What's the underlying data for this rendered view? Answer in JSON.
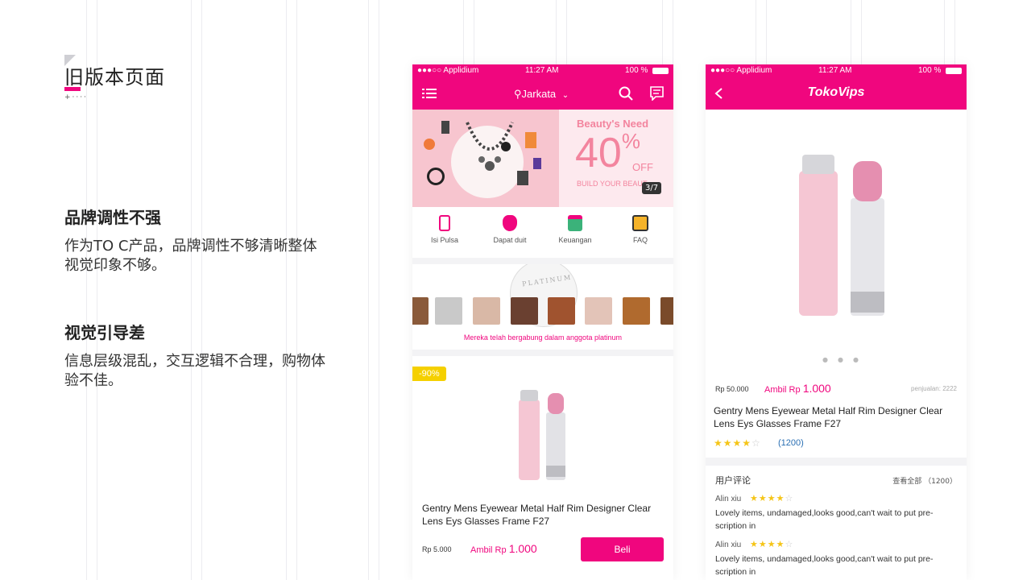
{
  "slide": {
    "title": "旧版本页面",
    "title_marker": "+····",
    "sections": [
      {
        "heading": "品牌调性不强",
        "body": "作为TO C产品，品牌调性不够清晰整体视觉印象不够。"
      },
      {
        "heading": "视觉引导差",
        "body": "信息层级混乱，交互逻辑不合理，购物体验不佳。"
      }
    ]
  },
  "colors": {
    "brand_pink": "#f0067e",
    "banner_pink": "#f3849e",
    "discount_yellow": "#f5d000",
    "star": "#f5c518"
  },
  "phone1": {
    "status": {
      "carrier": "●●●○○ Applidium",
      "time": "11:27 AM",
      "battery": "100 %"
    },
    "nav": {
      "location": "Jarkata",
      "menu_icon": "menu-icon",
      "search_icon": "search-icon",
      "message_icon": "message-icon"
    },
    "banner": {
      "title": "Beauty's Need",
      "percent": "40",
      "percent_sign": "%",
      "off": "OFF",
      "subtitle": "BUILD YOUR BEAUTY IN TOKOVIPS!",
      "page": "3/7"
    },
    "quick_links": [
      {
        "label": "Isi Pulsa",
        "icon": "phone-icon"
      },
      {
        "label": "Dapat duit",
        "icon": "money-bag-icon"
      },
      {
        "label": "Keuangan",
        "icon": "gift-icon"
      },
      {
        "label": "FAQ",
        "icon": "book-icon"
      }
    ],
    "platinum": {
      "badge": "PLATINUM",
      "text": "Mereka telah bergabung dalam anggota platinum"
    },
    "product": {
      "discount": "-90%",
      "name": "Gentry Mens Eyewear Metal Half Rim Designer Clear Lens Eys Glasses Frame F27",
      "price": "Rp 5.000",
      "ambil_label": "Ambil Rp",
      "ambil_value": "1.000",
      "buy_label": "Beli"
    }
  },
  "phone2": {
    "status": {
      "carrier": "●●●○○ Applidium",
      "time": "11:27 AM",
      "battery": "100 %"
    },
    "nav": {
      "logo": "TokoVips",
      "back_icon": "back-icon"
    },
    "product": {
      "price": "Rp 50.000",
      "ambil_label": "Ambil Rp",
      "ambil_value": "1.000",
      "sales": "penjualan: 2222",
      "name": "Gentry Mens Eyewear Metal Half Rim Designer Clear Lens Eys Glasses Frame F27",
      "rating": 4,
      "rating_count": "(1200)"
    },
    "reviews": {
      "title": "用户评论",
      "view_all": "查看全部 （1200）",
      "items": [
        {
          "user": "Alin xiu",
          "rating": 4,
          "text": "Lovely items, undamaged,looks good,can't wait to put pre-scription in"
        },
        {
          "user": "Alin xiu",
          "rating": 4,
          "text": "Lovely items, undamaged,looks good,can't wait to put pre-scription in"
        }
      ]
    }
  }
}
